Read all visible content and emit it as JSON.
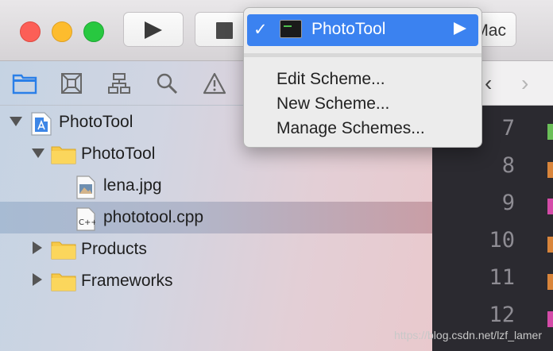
{
  "toolbar": {
    "run_icon": "play-icon",
    "stop_icon": "stop-icon",
    "destination_label": "Mac"
  },
  "navigator_tabs": [
    "folder-icon",
    "source-control-icon",
    "hierarchy-icon",
    "search-icon",
    "warning-icon"
  ],
  "tree": {
    "project": "PhotoTool",
    "group": "PhotoTool",
    "file_image": "lena.jpg",
    "file_source": "phototool.cpp",
    "products": "Products",
    "frameworks": "Frameworks"
  },
  "editor": {
    "line_numbers": [
      "7",
      "8",
      "9",
      "10",
      "11",
      "12"
    ]
  },
  "scheme_menu": {
    "selected_scheme": "PhotoTool",
    "items": [
      "Edit Scheme...",
      "New Scheme...",
      "Manage Schemes..."
    ]
  },
  "colors": {
    "menu_highlight": "#3b82f0",
    "editor_background": "#2b2a30",
    "folder_yellow": "#f7c948"
  },
  "watermark": "https://blog.csdn.net/lzf_lamer"
}
